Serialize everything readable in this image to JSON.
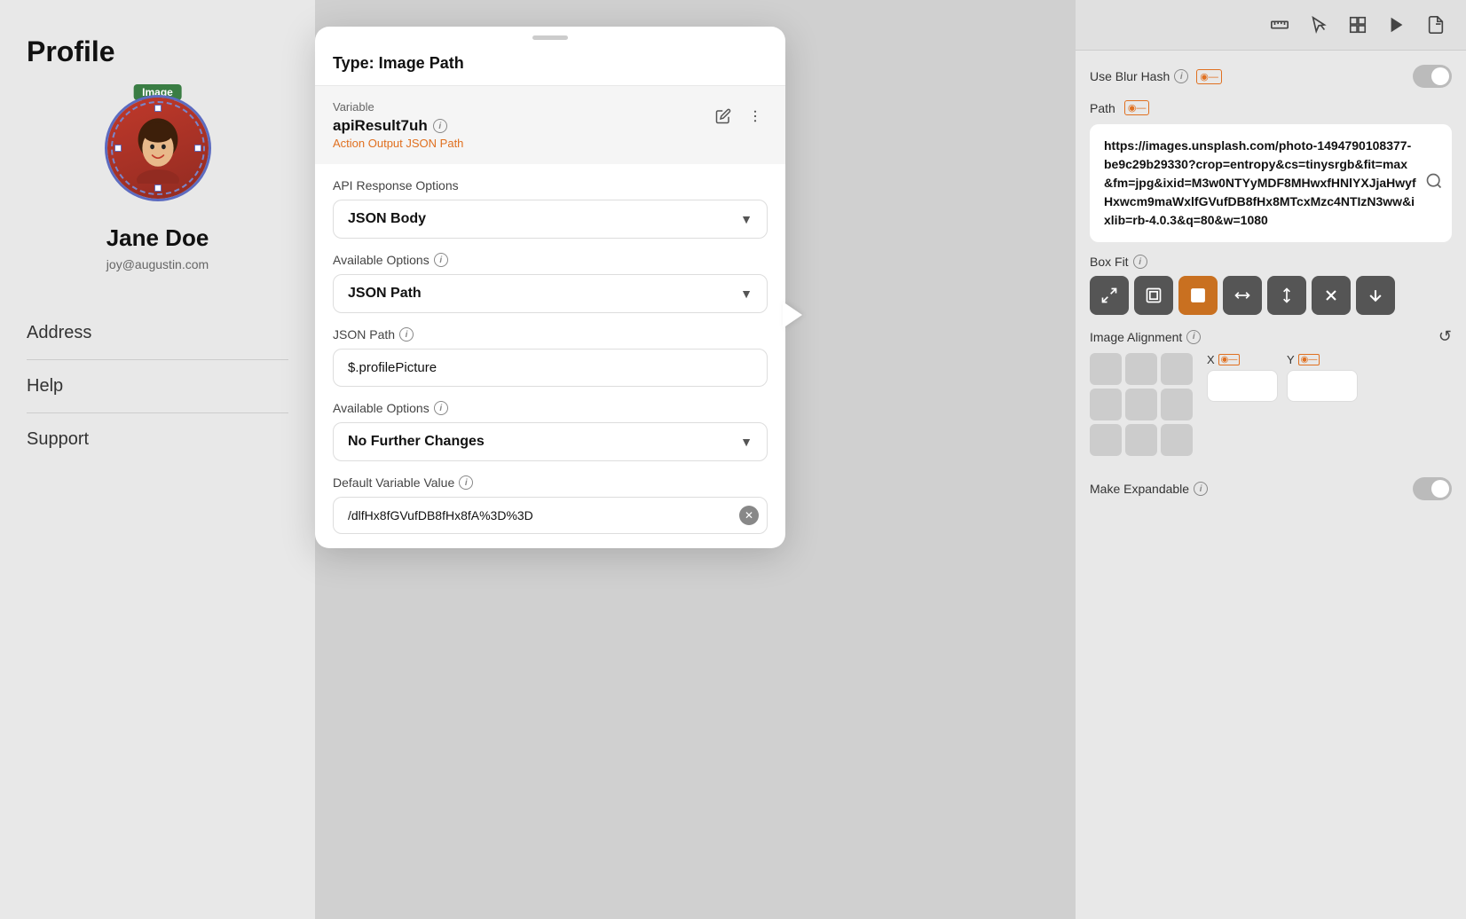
{
  "leftPanel": {
    "title": "Profile",
    "imageLabel": "Image",
    "profileName": "Jane Doe",
    "profileEmail": "joy@augustin.com",
    "navItems": [
      "Address",
      "Help",
      "Support"
    ]
  },
  "modal": {
    "dragHandle": true,
    "title": "Type: Image Path",
    "variableSection": {
      "label": "Variable",
      "name": "apiResult7uh",
      "subtitle": "Action Output JSON Path"
    },
    "apiResponseOptions": {
      "label": "API Response Options",
      "value": "JSON Body"
    },
    "availableOptions1": {
      "label": "Available Options",
      "value": "JSON Path"
    },
    "jsonPath": {
      "label": "JSON Path",
      "value": "$.profilePicture"
    },
    "availableOptions2": {
      "label": "Available Options",
      "value": "No Further Changes"
    },
    "defaultVariableValue": {
      "label": "Default Variable Value",
      "value": "/dlfHx8fGVufDB8fHx8fA%3D%3D"
    }
  },
  "rightPanel": {
    "urlValue": "https://images.unsplash.com/photo-1494790108377-be9c29b29330?crop=entropy&cs=tinysrgb&fit=max&fm=jpg&ixid=M3w0NTYyMDF8MHwxfHNlYXJjaHwyf Hxwcm9maWxlfGVufDB8fHx8MTcxMzc4NTIzN3ww&ixlib=rb-4.0.3&q=80&w=1080",
    "useBlurHash": "Use Blur Hash",
    "path": "Path",
    "boxFit": "Box Fit",
    "imageAlignment": "Image Alignment",
    "makeExpandable": "Make Expandable",
    "xLabel": "X",
    "yLabel": "Y"
  }
}
